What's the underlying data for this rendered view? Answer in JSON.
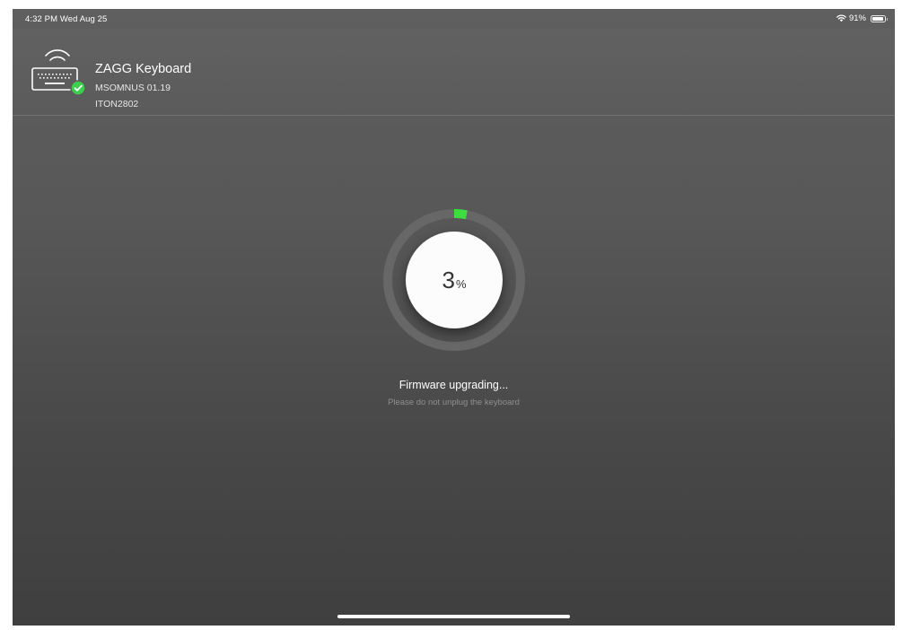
{
  "status_bar": {
    "time": "4:32 PM  Wed Aug 25",
    "wifi_icon": "wifi-icon",
    "battery_text": "91%",
    "battery_level": 0.91
  },
  "device": {
    "icon": "keyboard-icon",
    "name": "ZAGG Keyboard",
    "firmware": "MSOMNUS 01.19",
    "model": "ITON2802",
    "connected": true
  },
  "progress": {
    "value": "3",
    "unit": "%",
    "fraction": 0.03,
    "accent_color": "#3ddc3f"
  },
  "status": {
    "title": "Firmware upgrading...",
    "subtitle": "Please do not unplug the keyboard"
  }
}
